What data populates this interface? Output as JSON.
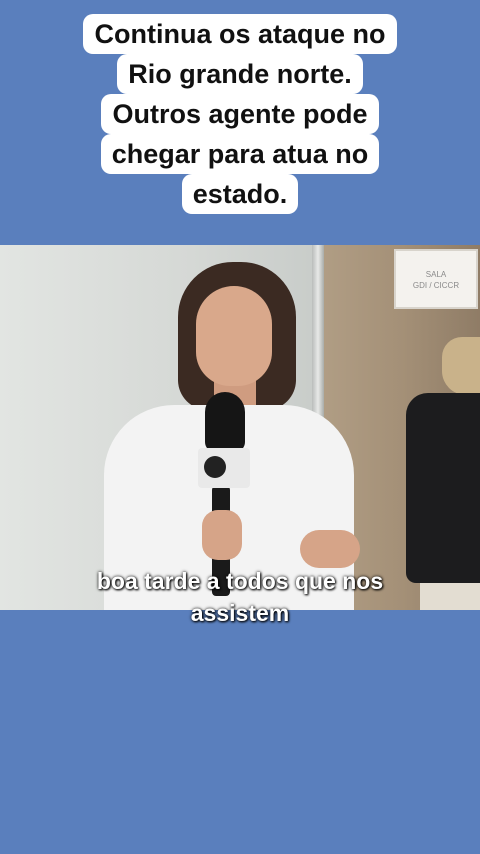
{
  "overlay_caption": {
    "lines": [
      "Continua os ataque no",
      "Rio grande norte.",
      "Outros agente pode",
      "chegar para atua no",
      "estado."
    ]
  },
  "video": {
    "sign_lines": [
      "SALA",
      "GDI / CICCR"
    ],
    "subtitle_lines": [
      "boa tarde a todos que nos",
      "assistem"
    ]
  },
  "colors": {
    "page_background": "#5a7fbd",
    "caption_background": "#ffffff",
    "caption_text": "#111111",
    "subtitle_text": "#ffffff"
  }
}
